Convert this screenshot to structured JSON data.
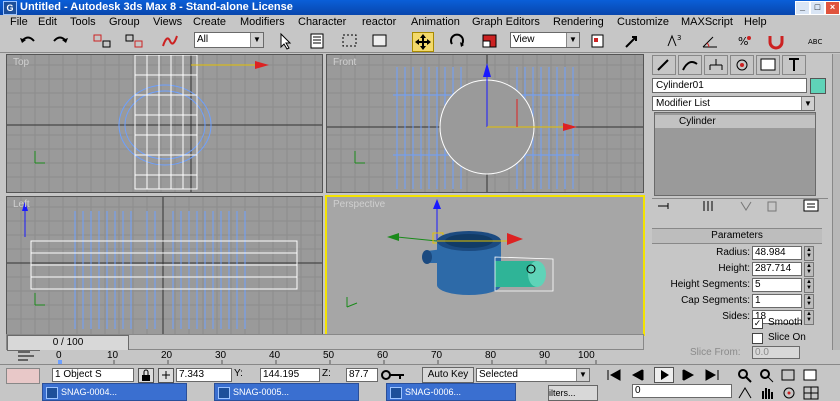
{
  "window": {
    "app_glyph": "G",
    "title": "Untitled - Autodesk 3ds Max 8 - Stand-alone License",
    "minimize": "_",
    "maximize": "□",
    "close": "×"
  },
  "menu": [
    "File",
    "Edit",
    "Tools",
    "Group",
    "Views",
    "Create",
    "Modifiers",
    "Character",
    "reactor",
    "Animation",
    "Graph Editors",
    "Rendering",
    "Customize",
    "MAXScript",
    "Help"
  ],
  "toolbar": {
    "selection_filter": "All",
    "ref_coord": "View"
  },
  "viewports": {
    "top_label": "Top",
    "front_label": "Front",
    "left_label": "Left",
    "persp_label": "Perspective"
  },
  "command_panel": {
    "object_name": "Cylinder01",
    "object_color": "#5fd3b8",
    "modifier_list": "Modifier List",
    "stack_item": "Cylinder",
    "rollout_title": "Parameters",
    "params": [
      {
        "label": "Radius:",
        "value": "48.984"
      },
      {
        "label": "Height:",
        "value": "287.714"
      },
      {
        "label": "Height Segments:",
        "value": "5"
      },
      {
        "label": "Cap Segments:",
        "value": "1"
      },
      {
        "label": "Sides:",
        "value": "18"
      }
    ],
    "smooth_label": "Smooth",
    "slice_on_label": "Slice On",
    "slice_from_label": "Slice From:",
    "slice_from_value": "0.0"
  },
  "timeline": {
    "frame_readout": "0 / 100",
    "ticks": [
      "0",
      "10",
      "20",
      "30",
      "40",
      "50",
      "60",
      "70",
      "80",
      "90",
      "100"
    ]
  },
  "status": {
    "selection": "1 Object S",
    "x_label": "X:",
    "x_value": "7.343",
    "y_label": "Y:",
    "y_value": "144.195",
    "z_label": "Z:",
    "z_value": "87.7",
    "autokey": "Auto Key",
    "selected": "Selected",
    "filters": "ilters...",
    "frame": "0"
  },
  "taskbar": [
    "SNAG-0004...",
    "SNAG-0005...",
    "SNAG-0006..."
  ]
}
